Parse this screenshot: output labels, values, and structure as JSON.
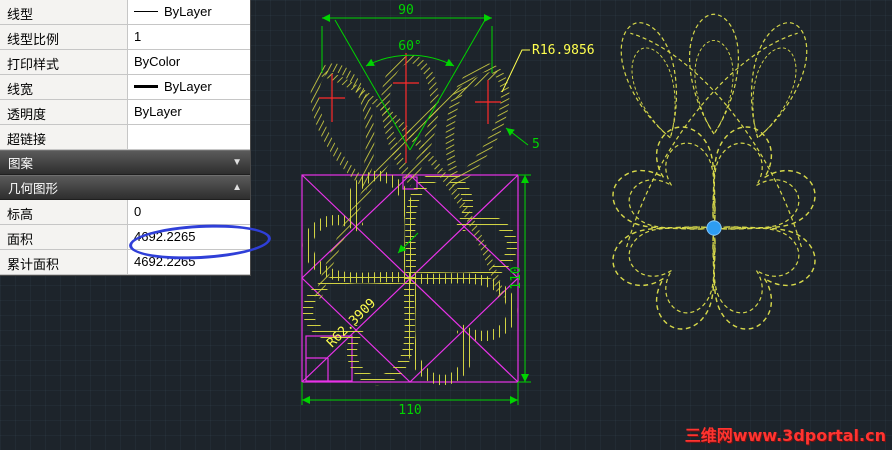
{
  "panel": {
    "rows": [
      {
        "label": "线型",
        "value": "ByLayer"
      },
      {
        "label": "线型比例",
        "value": "1"
      },
      {
        "label": "打印样式",
        "value": "ByColor"
      },
      {
        "label": "线宽",
        "value": "ByLayer"
      },
      {
        "label": "透明度",
        "value": "ByLayer"
      },
      {
        "label": "超链接",
        "value": ""
      }
    ],
    "sections": [
      {
        "label": "图案",
        "arrow": "▼"
      },
      {
        "label": "几何图形",
        "arrow": "▲"
      }
    ],
    "geometry_rows": [
      {
        "label": "标高",
        "value": "0"
      },
      {
        "label": "面积",
        "value": "4692.2265"
      },
      {
        "label": "累计面积",
        "value": "4692.2265"
      }
    ]
  },
  "canvas": {
    "dim_width_top": "90",
    "dim_angle": "60°",
    "label_radius_top": "R16.9856",
    "dim_offset": "5",
    "dim_height_right": "110",
    "dim_width_bottom": "110",
    "label_radius_inner": "R62.3909",
    "watermark": "三维网www.3dportal.cn"
  },
  "colors": {
    "hatch": "#d9d943",
    "dimension": "#00d400",
    "outline_magenta": "#e833e8",
    "annotation_blue": "#2f3fd8",
    "center_dot": "#2e9df2",
    "watermark_red": "#ff3430",
    "canvas_background": "#1d242b"
  }
}
